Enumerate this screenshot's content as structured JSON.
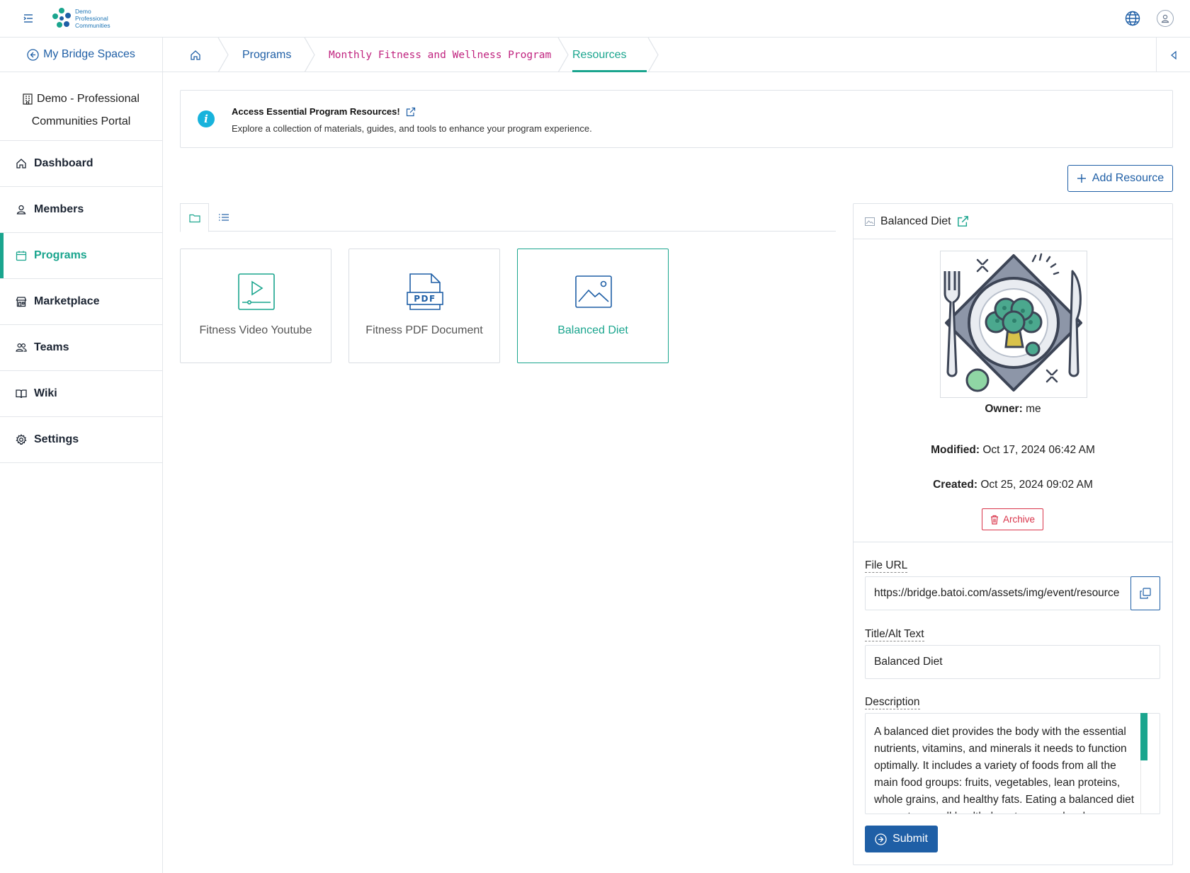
{
  "header": {
    "logo_text": [
      "Demo",
      "Professional",
      "Communities"
    ],
    "menu_icon": "menu-icon",
    "language_icon": "globe-icon",
    "profile_icon": "user-icon"
  },
  "sidebar": {
    "back_label": "My Bridge Spaces",
    "org_line1": "Demo - Professional",
    "org_line2": "Communities Portal",
    "items": [
      {
        "label": "Dashboard",
        "icon": "home-icon",
        "active": false
      },
      {
        "label": "Members",
        "icon": "user-icon",
        "active": false
      },
      {
        "label": "Programs",
        "icon": "calendar-icon",
        "active": true
      },
      {
        "label": "Marketplace",
        "icon": "store-icon",
        "active": false
      },
      {
        "label": "Teams",
        "icon": "users-icon",
        "active": false
      },
      {
        "label": "Wiki",
        "icon": "book-icon",
        "active": false
      },
      {
        "label": "Settings",
        "icon": "gear-icon",
        "active": false
      }
    ]
  },
  "breadcrumb": {
    "items": [
      "Programs",
      "Monthly Fitness and Wellness Program",
      "Resources"
    ],
    "active": "Resources"
  },
  "banner": {
    "title": "Access Essential Program Resources!",
    "description": "Explore a collection of materials, guides, and tools to enhance your program experience."
  },
  "toolbar": {
    "add_label": "Add Resource"
  },
  "view_tabs": {
    "active": "folder-view",
    "tabs": [
      "folder-view",
      "list-view"
    ]
  },
  "resources": [
    {
      "label": "Fitness Video Youtube",
      "icon": "video-icon",
      "selected": false
    },
    {
      "label": "Fitness PDF Document",
      "icon": "pdf-icon",
      "selected": false,
      "badge": "PDF"
    },
    {
      "label": "Balanced Diet",
      "icon": "image-icon",
      "selected": true
    }
  ],
  "details": {
    "title": "Balanced Diet",
    "owner_label": "Owner:",
    "owner": "me",
    "modified_label": "Modified:",
    "modified": "Oct 17, 2024 06:42 AM",
    "created_label": "Created:",
    "created": "Oct 25, 2024 09:02 AM",
    "archive_label": "Archive",
    "file_url_label": "File URL",
    "file_url": "https://bridge.batoi.com/assets/img/event/resource",
    "title_label": "Title/Alt Text",
    "title_value": "Balanced Diet",
    "description_label": "Description",
    "description": "A balanced diet provides the body with the essential nutrients, vitamins, and minerals it needs to function optimally. It includes a variety of foods from all the main food groups: fruits, vegetables, lean proteins, whole grains, and healthy fats. Eating a balanced diet supports overall health, boosts energy levels",
    "submit_label": "Submit"
  },
  "colors": {
    "accent": "#1aa58e",
    "primary": "#1f5fa6",
    "breadcrumb_program": "#c0237f",
    "danger": "#d9344a",
    "info": "#18b3dc"
  }
}
